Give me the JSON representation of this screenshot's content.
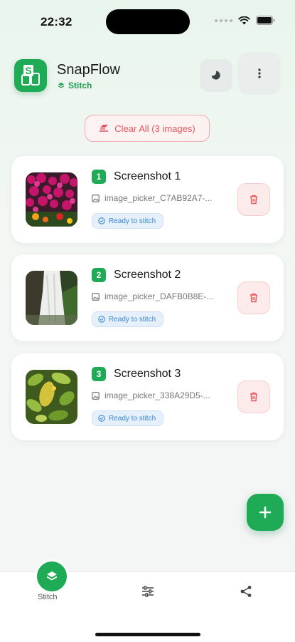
{
  "status_bar": {
    "time": "22:32"
  },
  "header": {
    "app_name": "SnapFlow",
    "mode_label": "Stitch"
  },
  "toolbar": {
    "clear_all_label": "Clear All (3 images)"
  },
  "images": [
    {
      "index": "1",
      "title": "Screenshot 1",
      "filename": "image_picker_C7AB92A7-...",
      "status": "Ready to stitch"
    },
    {
      "index": "2",
      "title": "Screenshot 2",
      "filename": "image_picker_DAFB0B8E-...",
      "status": "Ready to stitch"
    },
    {
      "index": "3",
      "title": "Screenshot 3",
      "filename": "image_picker_338A29D5-...",
      "status": "Ready to stitch"
    }
  ],
  "bottom_nav": {
    "stitch_label": "Stitch"
  },
  "colors": {
    "accent": "#1faa56",
    "danger": "#e2575c",
    "info": "#3b86d6"
  }
}
